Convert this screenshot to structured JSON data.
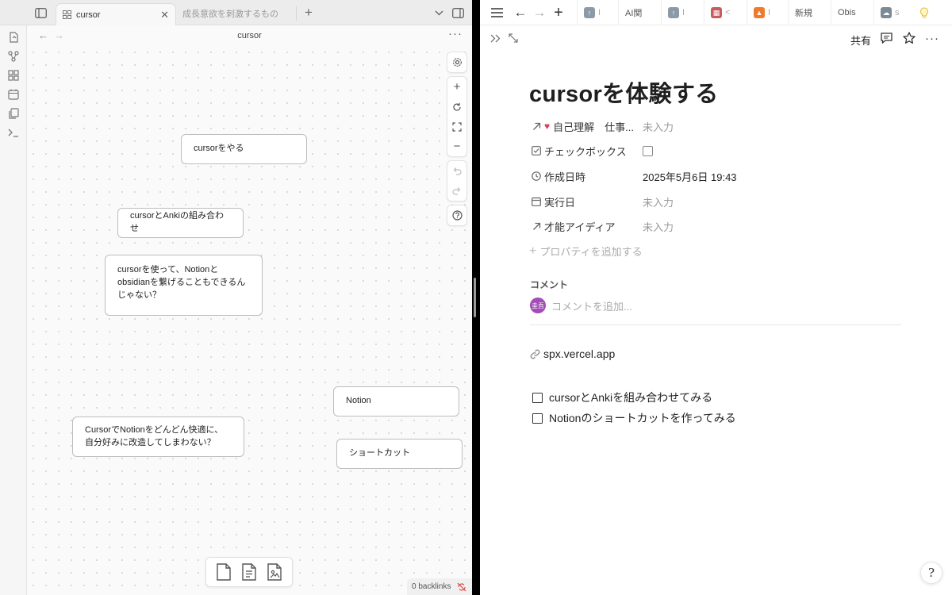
{
  "obsidian": {
    "tabs": [
      {
        "label": "cursor",
        "active": true
      },
      {
        "label": "成長意欲を刺激するもの",
        "active": false
      }
    ],
    "view_title": "cursor",
    "canvas_cards": [
      {
        "text": "cursorをやる"
      },
      {
        "text": "cursorとAnkiの組み合わせ"
      },
      {
        "text": "cursorを使って、Notionとobsidianを繋げることもできるんじゃない？"
      },
      {
        "text": "Notion"
      },
      {
        "text": "CursorでNotionをどんどん快適に、自分好みに改造してしまわない？"
      },
      {
        "text": "ショートカット"
      }
    ],
    "backlinks": "0 backlinks"
  },
  "notion": {
    "browser_tabs": [
      {
        "label": "I",
        "icon": "upload-icon"
      },
      {
        "label": "AI関",
        "icon": "text"
      },
      {
        "label": "I",
        "icon": "upload-icon"
      },
      {
        "label": "<",
        "icon": "store-icon"
      },
      {
        "label": "I",
        "icon": "fire-icon"
      },
      {
        "label": "新規",
        "icon": "text"
      },
      {
        "label": "Obis",
        "icon": "text"
      },
      {
        "label": "s",
        "icon": "cloud-icon"
      }
    ],
    "share_label": "共有",
    "page_title": "cursorを体験する",
    "properties": [
      {
        "icon": "relation-arrow-icon",
        "name": "自己理解　仕事...",
        "value": "未入力",
        "filled": false
      },
      {
        "icon": "checkbox-icon",
        "name": "チェックボックス",
        "value": "",
        "type": "checkbox"
      },
      {
        "icon": "clock-icon",
        "name": "作成日時",
        "value": "2025年5月6日 19:43",
        "filled": true
      },
      {
        "icon": "calendar-icon",
        "name": "実行日",
        "value": "未入力",
        "filled": false
      },
      {
        "icon": "relation-arrow-icon",
        "name": "才能アイディア",
        "value": "未入力",
        "filled": false
      }
    ],
    "add_property": "プロパティを追加する",
    "comments_label": "コメント",
    "avatar_text": "圭吾",
    "comment_placeholder": "コメントを追加...",
    "link_text": "spx.vercel.app",
    "todos": [
      {
        "text": "cursorとAnkiを組み合わせてみる",
        "checked": false
      },
      {
        "text": "Notionのショートカットを作ってみる",
        "checked": false
      }
    ],
    "help_label": "?"
  }
}
